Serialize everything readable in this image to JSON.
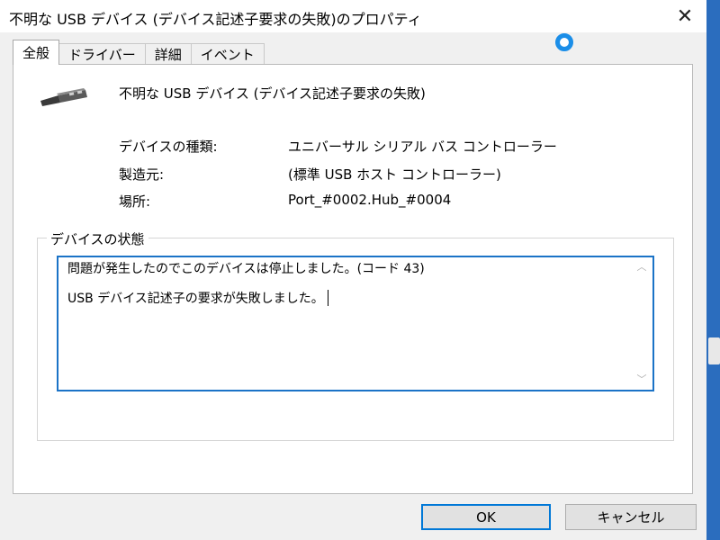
{
  "window": {
    "title": "不明な USB デバイス (デバイス記述子要求の失敗)のプロパティ",
    "close_glyph": "✕"
  },
  "tabs": [
    {
      "label": "全般",
      "active": true
    },
    {
      "label": "ドライバー",
      "active": false
    },
    {
      "label": "詳細",
      "active": false
    },
    {
      "label": "イベント",
      "active": false
    }
  ],
  "device": {
    "icon": "usb-connector-icon",
    "name": "不明な USB デバイス (デバイス記述子要求の失敗)"
  },
  "properties": [
    {
      "label": "デバイスの種類:",
      "value": "ユニバーサル シリアル バス コントローラー"
    },
    {
      "label": "製造元:",
      "value": "(標準 USB ホスト コントローラー)"
    },
    {
      "label": "場所:",
      "value": "Port_#0002.Hub_#0004"
    }
  ],
  "status": {
    "group_title": "デバイスの状態",
    "line1": "問題が発生したのでこのデバイスは停止しました。(コード 43)",
    "line2": "USB デバイス記述子の要求が失敗しました。"
  },
  "buttons": {
    "ok": "OK",
    "cancel": "キャンセル"
  },
  "colors": {
    "accent": "#0078d7",
    "busy_ring": "#1b8ee8"
  }
}
